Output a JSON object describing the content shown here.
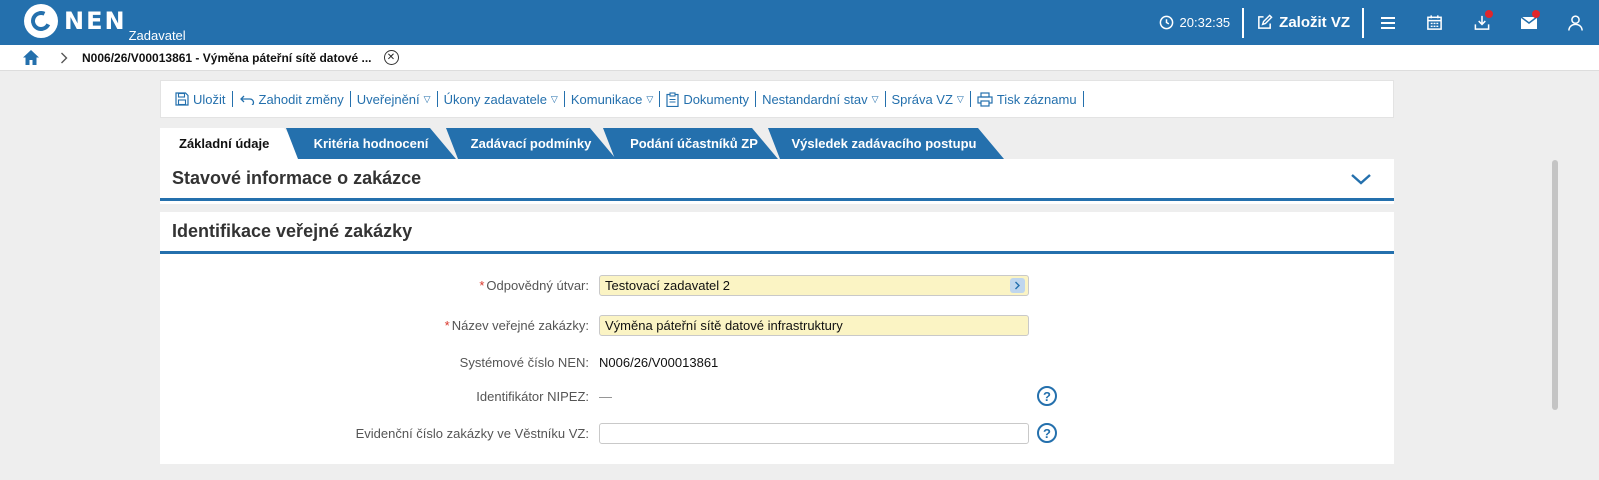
{
  "app": {
    "logo_text": "NEN",
    "logo_sub": "Zadavatel",
    "time": "20:32:35",
    "create_label": "Založit VZ",
    "icons": [
      "clock-icon",
      "edit-icon",
      "menu-icon",
      "calendar-icon",
      "download-icon",
      "mail-icon",
      "user-icon"
    ],
    "accent": "#2470ad",
    "notification_color": "#e0262b"
  },
  "breadcrumb": {
    "title": "N006/26/V00013861 - Výměna páteřní sítě datové ..."
  },
  "toolbar": {
    "save": "Uložit",
    "discard": "Zahodit změny",
    "publish": "Uveřejnění",
    "actions": "Úkony zadavatele",
    "communication": "Komunikace",
    "documents": "Dokumenty",
    "nonstandard": "Nestandardní stav",
    "manage": "Správa VZ",
    "print": "Tisk záznamu"
  },
  "tabs": {
    "basic": "Základní údaje",
    "criteria": "Kritéria hodnocení",
    "conditions": "Zadávací podmínky",
    "submissions": "Podání účastníků ZP",
    "result": "Výsledek zadávacího postupu"
  },
  "sections": {
    "status": "Stavové informace o zakázce",
    "identification": "Identifikace veřejné zakázky"
  },
  "form": {
    "unit_label": "Odpovědný útvar:",
    "unit_value": "Testovací zadavatel 2",
    "name_label": "Název veřejné zakázky:",
    "name_value": "Výměna páteřní sítě datové infrastruktury",
    "sysnum_label": "Systémové číslo NEN:",
    "sysnum_value": "N006/26/V00013861",
    "nipez_label": "Identifikátor NIPEZ:",
    "nipez_value": "—",
    "journal_label": "Evidenční číslo zakázky ve Věstníku VZ:",
    "journal_value": "",
    "required_mark": "*",
    "help_mark": "?"
  }
}
